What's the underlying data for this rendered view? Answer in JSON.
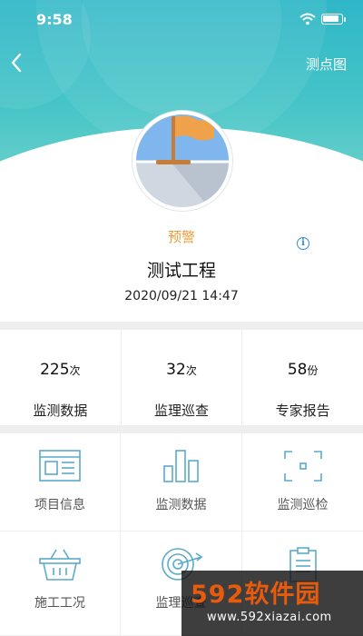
{
  "status_bar": {
    "time": "9:58"
  },
  "nav": {
    "back_icon": "chevron-left-icon",
    "right_link": "测点图"
  },
  "project": {
    "status": "预警",
    "status_color": "#e89d3c",
    "name": "测试工程",
    "datetime": "2020/09/21 14:47"
  },
  "stats": [
    {
      "value": "225",
      "unit": "次",
      "label": "监测数据"
    },
    {
      "value": "32",
      "unit": "次",
      "label": "监理巡查"
    },
    {
      "value": "58",
      "unit": "份",
      "label": "专家报告"
    }
  ],
  "menu": [
    {
      "icon": "project-info-icon",
      "label": "项目信息"
    },
    {
      "icon": "bar-chart-icon",
      "label": "监测数据"
    },
    {
      "icon": "scan-frame-icon",
      "label": "监测巡检"
    },
    {
      "icon": "basket-icon",
      "label": "施工工况"
    },
    {
      "icon": "target-icon",
      "label": "监理巡查"
    },
    {
      "icon": "clipboard-icon",
      "label": ""
    }
  ],
  "colors": {
    "header": "#2fb7c8",
    "accent": "#2f8ecf",
    "icon": "#5aaacc"
  },
  "watermark": {
    "logo": "592软件园",
    "url": "www.592xiazai.com"
  }
}
